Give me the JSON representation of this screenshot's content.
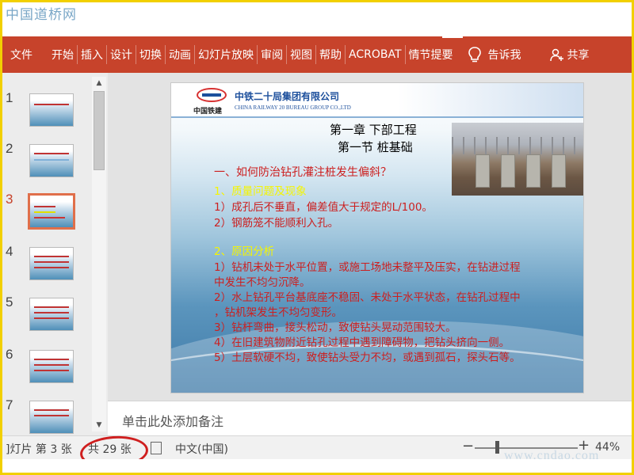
{
  "watermark_top": "中国道桥网",
  "watermark_bottom": "www.cndao.com",
  "ribbon": {
    "tabs": [
      "文件",
      "开始",
      "插入",
      "设计",
      "切换",
      "动画",
      "幻灯片放映",
      "审阅",
      "视图",
      "帮助",
      "ACROBAT",
      "情节提要"
    ],
    "tell_me": "告诉我",
    "share": "共享",
    "colors": {
      "ribbon_bg": "#c7432b"
    }
  },
  "thumbnails": {
    "numbers": [
      "1",
      "2",
      "3",
      "4",
      "5",
      "6",
      "7"
    ],
    "selected_index": 3
  },
  "slide": {
    "company_cn": "中铁二十局集团有限公司",
    "company_en": "CHINA RAILWAY 20 BUREAU GROUP CO.,LTD",
    "logo_caption": "中国铁建",
    "title_line1": "第一章  下部工程",
    "title_line2": "第一节  桩基础",
    "question": "一、如何防治钻孔灌注桩发生偏斜？",
    "section1_heading": "1、质量问题及现象",
    "section1_items": [
      "1）成孔后不垂直，偏差值大于规定的L/100。",
      "2）钢筋笼不能顺利入孔。"
    ],
    "section2_heading": "2、原因分析",
    "section2_items": [
      "1）钻机未处于水平位置，或施工场地未整平及压实，在钻进过程",
      "中发生不均匀沉降。",
      "2）水上钻孔平台基底座不稳固、未处于水平状态，在钻孔过程中",
      "，钻机架发生不均匀变形。",
      "3）钻杆弯曲，接头松动，致使钻头晃动范围较大。",
      "4）在旧建筑物附近钻孔过程中遇到障碍物，把钻头挤向一侧。",
      "5）土层软硬不均，致使钻头受力不均，或遇到孤石，探头石等。"
    ]
  },
  "notes_placeholder": "单击此处添加备注",
  "status": {
    "slide_of": "]灯片 第 3 张",
    "total": "共 29 张",
    "language": "中文(中国)",
    "zoom_minus": "−",
    "zoom_plus": "+",
    "zoom_level": "44%"
  }
}
